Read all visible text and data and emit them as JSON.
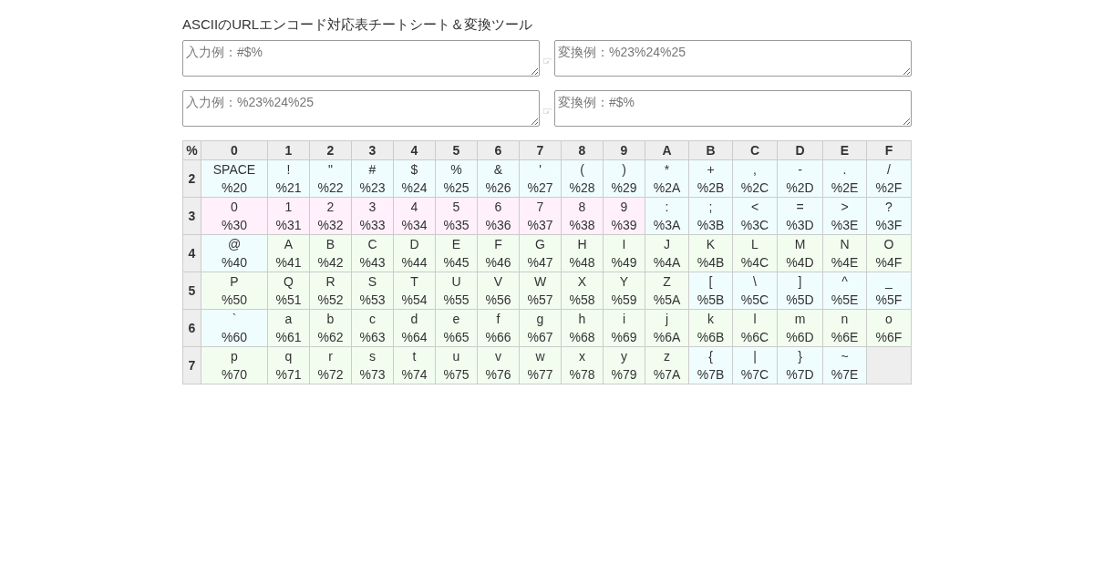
{
  "title": "ASCIIのURLエンコード対応表チートシート＆変換ツール",
  "converters": [
    {
      "input_placeholder": "入力例：#$%",
      "arrow": "☞",
      "output_placeholder": "変換例：%23%24%25"
    },
    {
      "input_placeholder": "入力例：%23%24%25",
      "arrow": "☞",
      "output_placeholder": "変換例：#$%"
    }
  ],
  "table": {
    "corner": "%",
    "columns": [
      "0",
      "1",
      "2",
      "3",
      "4",
      "5",
      "6",
      "7",
      "8",
      "9",
      "A",
      "B",
      "C",
      "D",
      "E",
      "F"
    ],
    "rows": [
      {
        "header": "2",
        "cells": [
          {
            "char": "SPACE",
            "code": "%20",
            "kind": "symbol"
          },
          {
            "char": "!",
            "code": "%21",
            "kind": "symbol"
          },
          {
            "char": "\"",
            "code": "%22",
            "kind": "symbol"
          },
          {
            "char": "#",
            "code": "%23",
            "kind": "symbol"
          },
          {
            "char": "$",
            "code": "%24",
            "kind": "symbol"
          },
          {
            "char": "%",
            "code": "%25",
            "kind": "symbol"
          },
          {
            "char": "&",
            "code": "%26",
            "kind": "symbol"
          },
          {
            "char": "'",
            "code": "%27",
            "kind": "symbol"
          },
          {
            "char": "(",
            "code": "%28",
            "kind": "symbol"
          },
          {
            "char": ")",
            "code": "%29",
            "kind": "symbol"
          },
          {
            "char": "*",
            "code": "%2A",
            "kind": "symbol"
          },
          {
            "char": "+",
            "code": "%2B",
            "kind": "symbol"
          },
          {
            "char": ",",
            "code": "%2C",
            "kind": "symbol"
          },
          {
            "char": "-",
            "code": "%2D",
            "kind": "symbol"
          },
          {
            "char": ".",
            "code": "%2E",
            "kind": "symbol"
          },
          {
            "char": "/",
            "code": "%2F",
            "kind": "symbol"
          }
        ]
      },
      {
        "header": "3",
        "cells": [
          {
            "char": "0",
            "code": "%30",
            "kind": "digit"
          },
          {
            "char": "1",
            "code": "%31",
            "kind": "digit"
          },
          {
            "char": "2",
            "code": "%32",
            "kind": "digit"
          },
          {
            "char": "3",
            "code": "%33",
            "kind": "digit"
          },
          {
            "char": "4",
            "code": "%34",
            "kind": "digit"
          },
          {
            "char": "5",
            "code": "%35",
            "kind": "digit"
          },
          {
            "char": "6",
            "code": "%36",
            "kind": "digit"
          },
          {
            "char": "7",
            "code": "%37",
            "kind": "digit"
          },
          {
            "char": "8",
            "code": "%38",
            "kind": "digit"
          },
          {
            "char": "9",
            "code": "%39",
            "kind": "digit"
          },
          {
            "char": ":",
            "code": "%3A",
            "kind": "symbol"
          },
          {
            "char": ";",
            "code": "%3B",
            "kind": "symbol"
          },
          {
            "char": "<",
            "code": "%3C",
            "kind": "symbol"
          },
          {
            "char": "=",
            "code": "%3D",
            "kind": "symbol"
          },
          {
            "char": ">",
            "code": "%3E",
            "kind": "symbol"
          },
          {
            "char": "?",
            "code": "%3F",
            "kind": "symbol"
          }
        ]
      },
      {
        "header": "4",
        "cells": [
          {
            "char": "@",
            "code": "%40",
            "kind": "symbol"
          },
          {
            "char": "A",
            "code": "%41",
            "kind": "letter"
          },
          {
            "char": "B",
            "code": "%42",
            "kind": "letter"
          },
          {
            "char": "C",
            "code": "%43",
            "kind": "letter"
          },
          {
            "char": "D",
            "code": "%44",
            "kind": "letter"
          },
          {
            "char": "E",
            "code": "%45",
            "kind": "letter"
          },
          {
            "char": "F",
            "code": "%46",
            "kind": "letter"
          },
          {
            "char": "G",
            "code": "%47",
            "kind": "letter"
          },
          {
            "char": "H",
            "code": "%48",
            "kind": "letter"
          },
          {
            "char": "I",
            "code": "%49",
            "kind": "letter"
          },
          {
            "char": "J",
            "code": "%4A",
            "kind": "letter"
          },
          {
            "char": "K",
            "code": "%4B",
            "kind": "letter"
          },
          {
            "char": "L",
            "code": "%4C",
            "kind": "letter"
          },
          {
            "char": "M",
            "code": "%4D",
            "kind": "letter"
          },
          {
            "char": "N",
            "code": "%4E",
            "kind": "letter"
          },
          {
            "char": "O",
            "code": "%4F",
            "kind": "letter"
          }
        ]
      },
      {
        "header": "5",
        "cells": [
          {
            "char": "P",
            "code": "%50",
            "kind": "letter"
          },
          {
            "char": "Q",
            "code": "%51",
            "kind": "letter"
          },
          {
            "char": "R",
            "code": "%52",
            "kind": "letter"
          },
          {
            "char": "S",
            "code": "%53",
            "kind": "letter"
          },
          {
            "char": "T",
            "code": "%54",
            "kind": "letter"
          },
          {
            "char": "U",
            "code": "%55",
            "kind": "letter"
          },
          {
            "char": "V",
            "code": "%56",
            "kind": "letter"
          },
          {
            "char": "W",
            "code": "%57",
            "kind": "letter"
          },
          {
            "char": "X",
            "code": "%58",
            "kind": "letter"
          },
          {
            "char": "Y",
            "code": "%59",
            "kind": "letter"
          },
          {
            "char": "Z",
            "code": "%5A",
            "kind": "letter"
          },
          {
            "char": "[",
            "code": "%5B",
            "kind": "symbol"
          },
          {
            "char": "\\",
            "code": "%5C",
            "kind": "symbol"
          },
          {
            "char": "]",
            "code": "%5D",
            "kind": "symbol"
          },
          {
            "char": "^",
            "code": "%5E",
            "kind": "symbol"
          },
          {
            "char": "_",
            "code": "%5F",
            "kind": "symbol"
          }
        ]
      },
      {
        "header": "6",
        "cells": [
          {
            "char": "`",
            "code": "%60",
            "kind": "symbol"
          },
          {
            "char": "a",
            "code": "%61",
            "kind": "letter"
          },
          {
            "char": "b",
            "code": "%62",
            "kind": "letter"
          },
          {
            "char": "c",
            "code": "%63",
            "kind": "letter"
          },
          {
            "char": "d",
            "code": "%64",
            "kind": "letter"
          },
          {
            "char": "e",
            "code": "%65",
            "kind": "letter"
          },
          {
            "char": "f",
            "code": "%66",
            "kind": "letter"
          },
          {
            "char": "g",
            "code": "%67",
            "kind": "letter"
          },
          {
            "char": "h",
            "code": "%68",
            "kind": "letter"
          },
          {
            "char": "i",
            "code": "%69",
            "kind": "letter"
          },
          {
            "char": "j",
            "code": "%6A",
            "kind": "letter"
          },
          {
            "char": "k",
            "code": "%6B",
            "kind": "letter"
          },
          {
            "char": "l",
            "code": "%6C",
            "kind": "letter"
          },
          {
            "char": "m",
            "code": "%6D",
            "kind": "letter"
          },
          {
            "char": "n",
            "code": "%6E",
            "kind": "letter"
          },
          {
            "char": "o",
            "code": "%6F",
            "kind": "letter"
          }
        ]
      },
      {
        "header": "7",
        "cells": [
          {
            "char": "p",
            "code": "%70",
            "kind": "letter"
          },
          {
            "char": "q",
            "code": "%71",
            "kind": "letter"
          },
          {
            "char": "r",
            "code": "%72",
            "kind": "letter"
          },
          {
            "char": "s",
            "code": "%73",
            "kind": "letter"
          },
          {
            "char": "t",
            "code": "%74",
            "kind": "letter"
          },
          {
            "char": "u",
            "code": "%75",
            "kind": "letter"
          },
          {
            "char": "v",
            "code": "%76",
            "kind": "letter"
          },
          {
            "char": "w",
            "code": "%77",
            "kind": "letter"
          },
          {
            "char": "x",
            "code": "%78",
            "kind": "letter"
          },
          {
            "char": "y",
            "code": "%79",
            "kind": "letter"
          },
          {
            "char": "z",
            "code": "%7A",
            "kind": "letter"
          },
          {
            "char": "{",
            "code": "%7B",
            "kind": "symbol"
          },
          {
            "char": "|",
            "code": "%7C",
            "kind": "symbol"
          },
          {
            "char": "}",
            "code": "%7D",
            "kind": "symbol"
          },
          {
            "char": "~",
            "code": "%7E",
            "kind": "symbol"
          }
        ]
      }
    ]
  }
}
